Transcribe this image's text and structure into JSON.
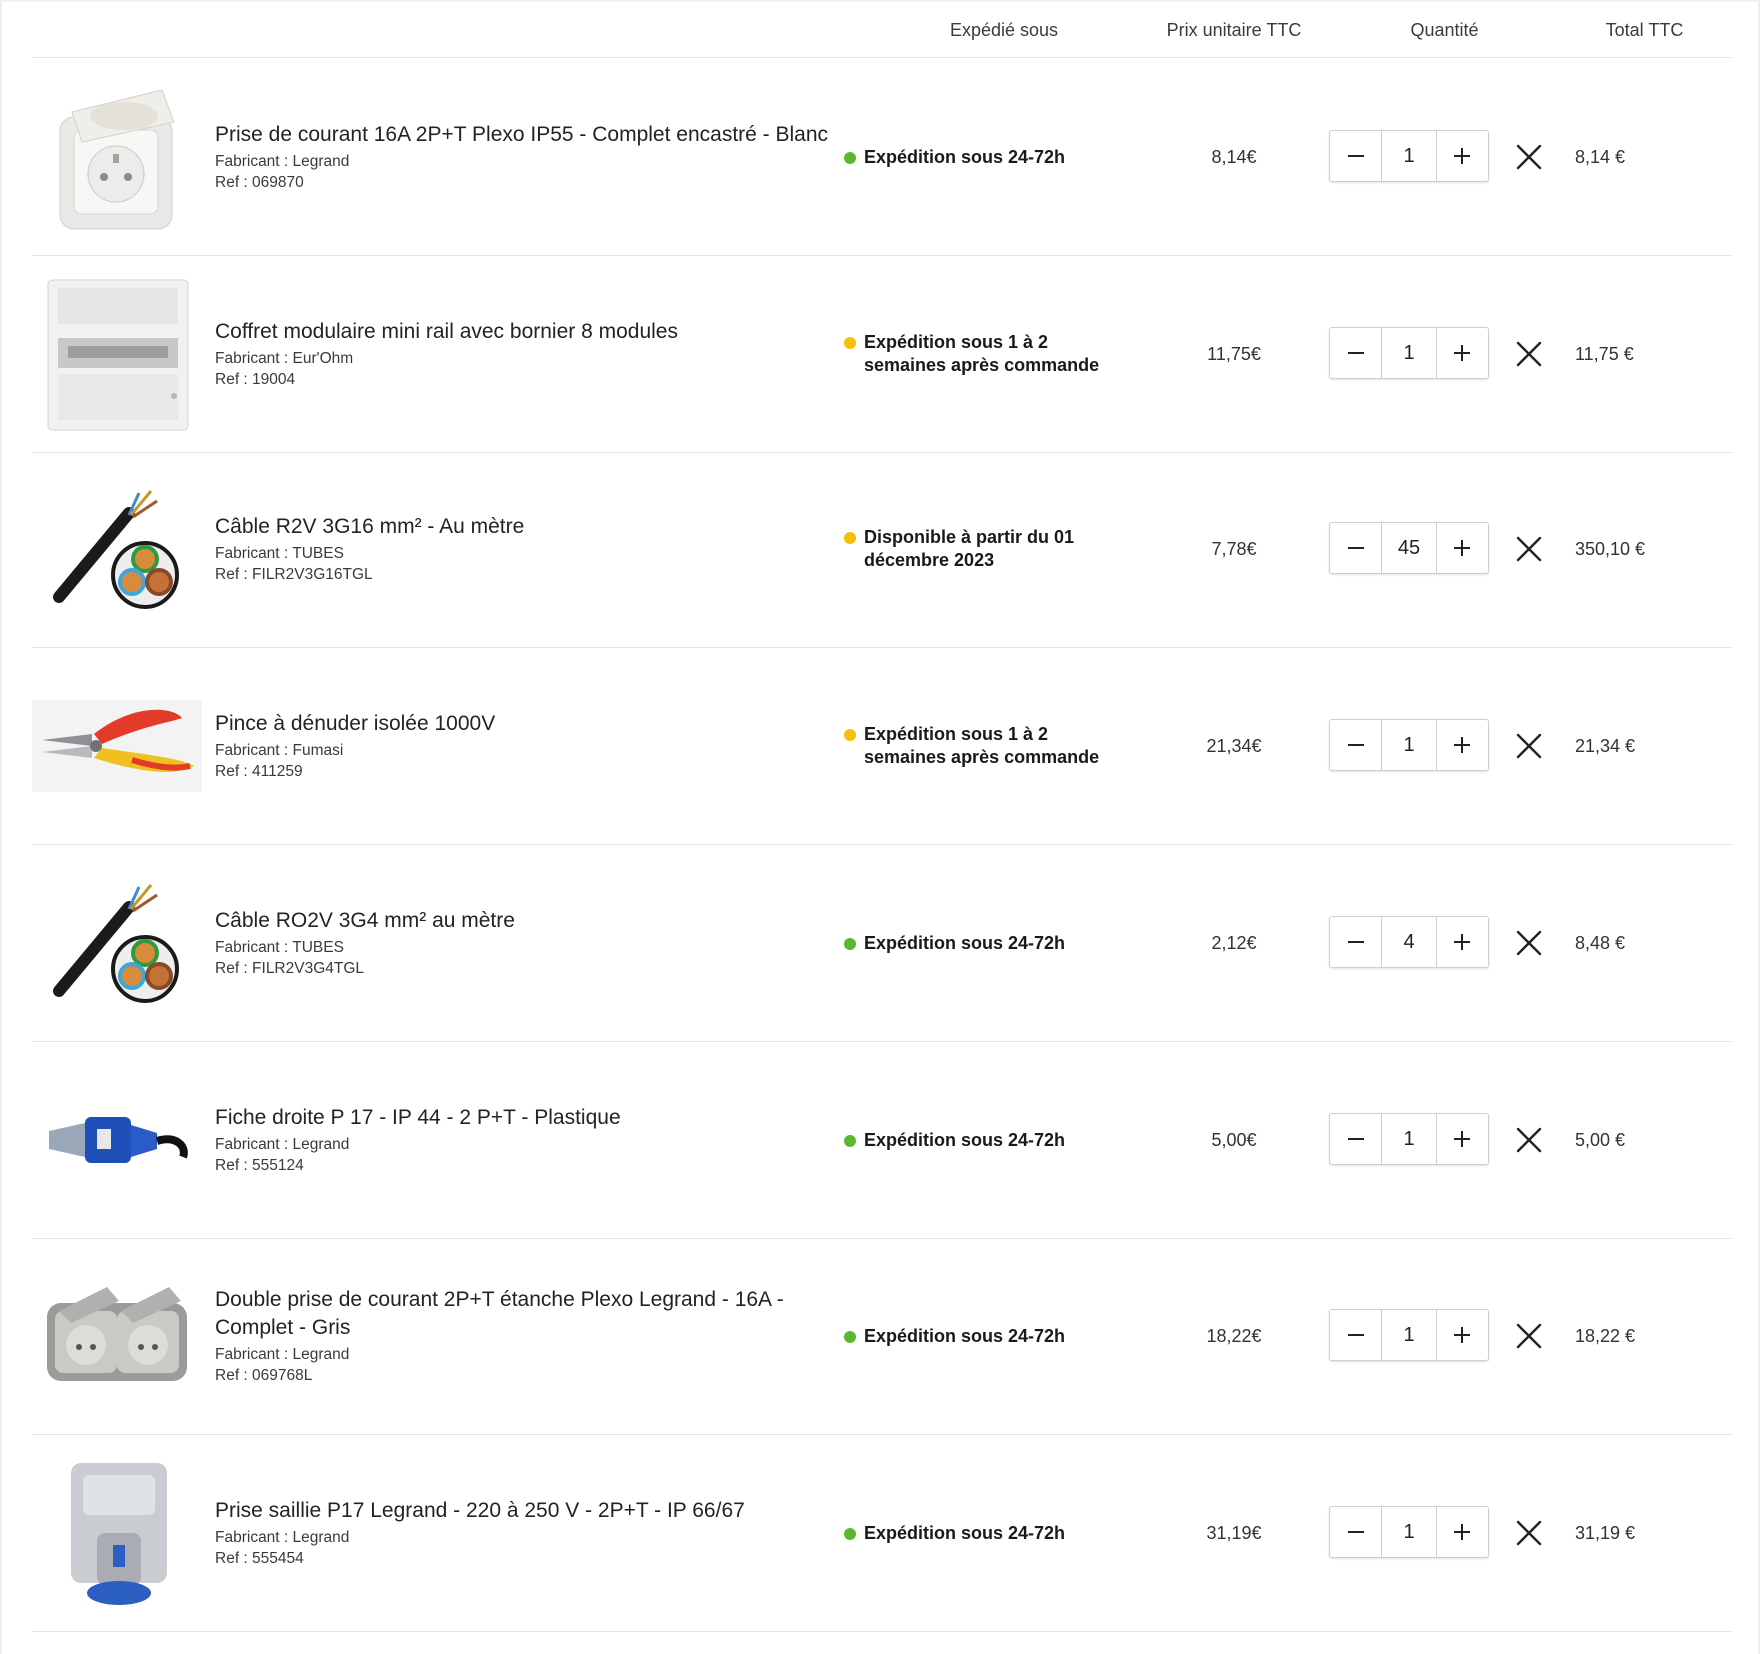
{
  "colors": {
    "green": "#5ab82e",
    "yellow": "#f5be0b",
    "divider": "#e3e3e3"
  },
  "header": {
    "shipped": "Expédié sous",
    "unit_price": "Prix unitaire TTC",
    "quantity": "Quantité",
    "total": "Total TTC"
  },
  "items": [
    {
      "name": "Prise de courant 16A 2P+T Plexo IP55 - Complet encastré - Blanc",
      "maker": "Fabricant : Legrand",
      "ref": "Ref : 069870",
      "status": "green",
      "shipping": "Expédition sous 24-72h",
      "unit_price": "8,14€",
      "qty": "1",
      "total": "8,14 €",
      "image": "white-socket-icon"
    },
    {
      "name": "Coffret modulaire mini rail avec bornier 8 modules",
      "maker": "Fabricant : Eur'Ohm",
      "ref": "Ref : 19004",
      "status": "yellow",
      "shipping": "Expédition sous 1 à 2 semaines après commande",
      "unit_price": "11,75€",
      "qty": "1",
      "total": "11,75 €",
      "image": "enclosure-icon"
    },
    {
      "name": "Câble R2V 3G16 mm² - Au mètre",
      "maker": "Fabricant : TUBES",
      "ref": "Ref : FILR2V3G16TGL",
      "status": "yellow",
      "shipping": "Disponible à partir du 01 décembre 2023",
      "unit_price": "7,78€",
      "qty": "45",
      "total": "350,10 €",
      "image": "cable-icon"
    },
    {
      "name": "Pince à dénuder isolée 1000V",
      "maker": "Fabricant : Fumasi",
      "ref": "Ref : 411259",
      "status": "yellow",
      "shipping": "Expédition sous 1 à 2 semaines après commande",
      "unit_price": "21,34€",
      "qty": "1",
      "total": "21,34 €",
      "image": "pliers-icon"
    },
    {
      "name": "Câble RO2V 3G4 mm² au mètre",
      "maker": "Fabricant : TUBES",
      "ref": "Ref : FILR2V3G4TGL",
      "status": "green",
      "shipping": "Expédition sous 24-72h",
      "unit_price": "2,12€",
      "qty": "4",
      "total": "8,48 €",
      "image": "cable-icon"
    },
    {
      "name": "Fiche droite P 17 - IP 44 - 2 P+T - Plastique",
      "maker": "Fabricant : Legrand",
      "ref": "Ref : 555124",
      "status": "green",
      "shipping": "Expédition sous 24-72h",
      "unit_price": "5,00€",
      "qty": "1",
      "total": "5,00 €",
      "image": "plug-icon"
    },
    {
      "name": "Double prise de courant 2P+T étanche Plexo Legrand - 16A - Complet - Gris",
      "maker": "Fabricant : Legrand",
      "ref": "Ref : 069768L",
      "status": "green",
      "shipping": "Expédition sous 24-72h",
      "unit_price": "18,22€",
      "qty": "1",
      "total": "18,22 €",
      "image": "double-socket-icon"
    },
    {
      "name": "Prise saillie P17 Legrand - 220 à 250 V - 2P+T - IP 66/67",
      "maker": "Fabricant : Legrand",
      "ref": "Ref : 555454",
      "status": "green",
      "shipping": "Expédition sous 24-72h",
      "unit_price": "31,19€",
      "qty": "1",
      "total": "31,19 €",
      "image": "surface-socket-icon"
    }
  ]
}
